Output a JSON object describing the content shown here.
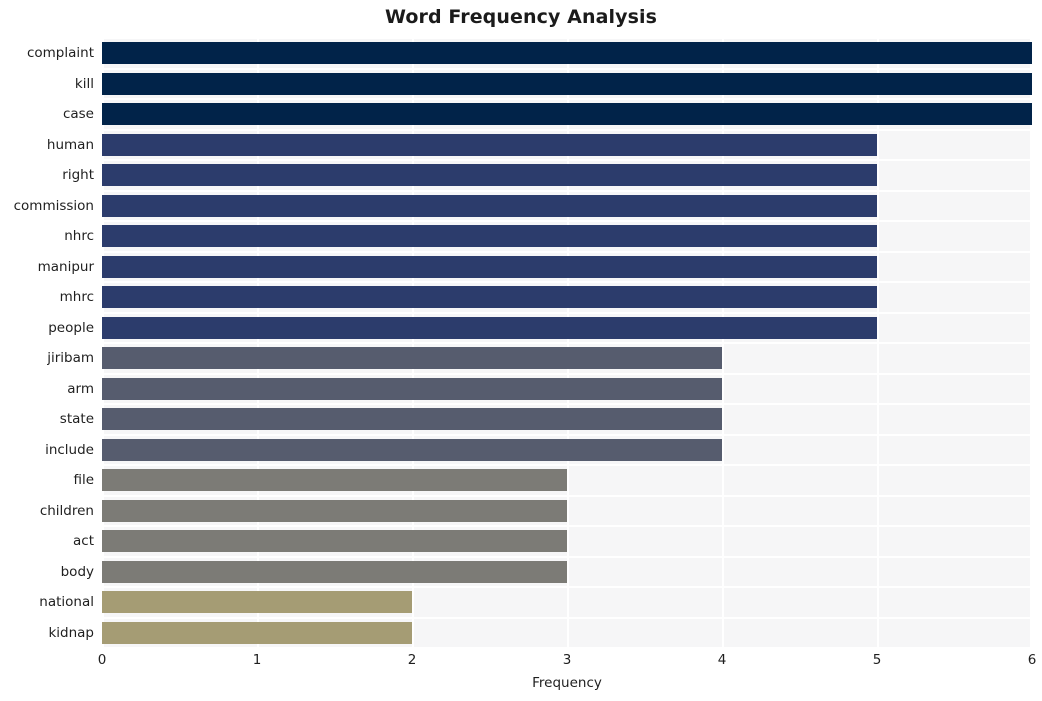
{
  "chart_data": {
    "type": "bar",
    "orientation": "horizontal",
    "title": "Word Frequency Analysis",
    "xlabel": "Frequency",
    "ylabel": "",
    "xlim": [
      0,
      6
    ],
    "xticks": [
      0,
      1,
      2,
      3,
      4,
      5,
      6
    ],
    "xtick_labels": [
      "0",
      "1",
      "2",
      "3",
      "4",
      "5",
      "6"
    ],
    "grid": true,
    "legend": null,
    "categories": [
      "complaint",
      "kill",
      "case",
      "human",
      "right",
      "commission",
      "nhrc",
      "manipur",
      "mhrc",
      "people",
      "jiribam",
      "arm",
      "state",
      "include",
      "file",
      "children",
      "act",
      "body",
      "national",
      "kidnap"
    ],
    "values": [
      6,
      6,
      6,
      5,
      5,
      5,
      5,
      5,
      5,
      5,
      4,
      4,
      4,
      4,
      3,
      3,
      3,
      3,
      2,
      2
    ],
    "bar_colors": [
      "#012349",
      "#012349",
      "#012349",
      "#2c3c6c",
      "#2c3c6c",
      "#2c3c6c",
      "#2c3c6c",
      "#2c3c6c",
      "#2c3c6c",
      "#2c3c6c",
      "#565c6e",
      "#565c6e",
      "#565c6e",
      "#565c6e",
      "#7c7b76",
      "#7c7b76",
      "#7c7b76",
      "#7c7b76",
      "#a59c74",
      "#a59c74"
    ],
    "style": {
      "plot_background": "#f6f6f7",
      "figure_background": "#ffffff",
      "gridline_color": "#ffffff",
      "text_color": "#1f1f1f"
    }
  }
}
